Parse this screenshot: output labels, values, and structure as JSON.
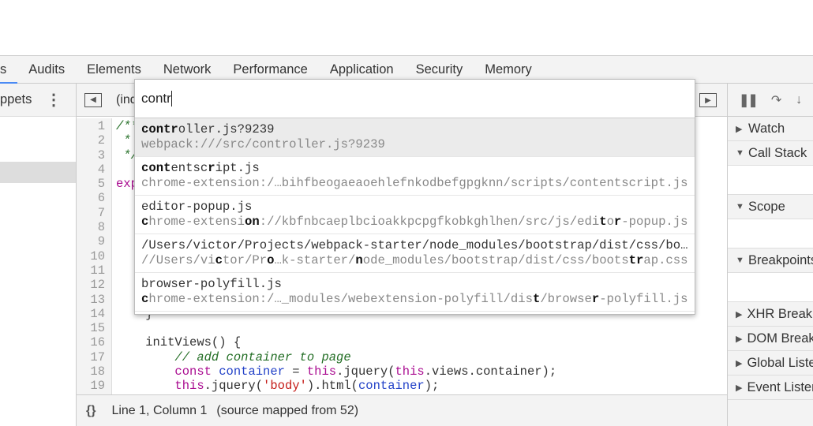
{
  "tabs": [
    "s",
    "Audits",
    "Elements",
    "Network",
    "Performance",
    "Application",
    "Security",
    "Memory"
  ],
  "sidebar": {
    "title": "ppets",
    "menu_icon": "kebab-icon"
  },
  "editor": {
    "file_label": "(ind",
    "lines": [
      {
        "n": "1",
        "parts": [
          [
            "c-com",
            "/**"
          ]
        ]
      },
      {
        "n": "2",
        "parts": [
          [
            "c-com",
            " *"
          ]
        ]
      },
      {
        "n": "3",
        "parts": [
          [
            "c-com",
            " */"
          ]
        ]
      },
      {
        "n": "4",
        "parts": []
      },
      {
        "n": "5",
        "parts": [
          [
            "c-kw",
            "exp"
          ]
        ]
      },
      {
        "n": "6",
        "parts": []
      },
      {
        "n": "7",
        "parts": []
      },
      {
        "n": "8",
        "parts": []
      },
      {
        "n": "9",
        "parts": []
      },
      {
        "n": "10",
        "parts": []
      },
      {
        "n": "11",
        "parts": []
      },
      {
        "n": "12",
        "parts": []
      },
      {
        "n": "13",
        "parts": []
      },
      {
        "n": "14",
        "parts": [
          [
            "",
            "    }"
          ]
        ]
      },
      {
        "n": "15",
        "parts": []
      },
      {
        "n": "16",
        "parts": [
          [
            "",
            "    initViews() {"
          ]
        ]
      },
      {
        "n": "17",
        "parts": [
          [
            "c-com",
            "        // add container to page"
          ]
        ]
      },
      {
        "n": "18",
        "parts": [
          [
            "c-kw",
            "        const "
          ],
          [
            "c-var",
            "container"
          ],
          [
            "",
            " = "
          ],
          [
            "c-kw",
            "this"
          ],
          [
            "",
            ".jquery("
          ],
          [
            "c-kw",
            "this"
          ],
          [
            "",
            ".views.container);"
          ]
        ]
      },
      {
        "n": "19",
        "parts": [
          [
            "c-kw",
            "        this"
          ],
          [
            "",
            ".jquery("
          ],
          [
            "c-str",
            "'body'"
          ],
          [
            "",
            ").html("
          ],
          [
            "c-var",
            "container"
          ],
          [
            "",
            ");"
          ]
        ]
      }
    ]
  },
  "status": {
    "braces": "{}",
    "position": "Line 1, Column 1",
    "mapped": "(source mapped from 52)"
  },
  "right": {
    "sections": [
      {
        "label": "Watch",
        "open": false
      },
      {
        "label": "Call Stack",
        "open": true
      },
      {
        "label": "Scope",
        "open": true
      },
      {
        "label": "Breakpoints",
        "open": true
      },
      {
        "label": "XHR Breakpoints",
        "open": false
      },
      {
        "label": "DOM Breakpoints",
        "open": false
      },
      {
        "label": "Global Listeners",
        "open": false
      },
      {
        "label": "Event Listeners",
        "open": false
      }
    ]
  },
  "quick_open": {
    "query": "contr",
    "items": [
      {
        "title": [
          [
            "contr",
            1
          ],
          [
            "oller.js?9239",
            0
          ]
        ],
        "path": [
          [
            "webpack:///src/controller.js?9239",
            0
          ]
        ]
      },
      {
        "title": [
          [
            "cont",
            1
          ],
          [
            "entsc",
            0
          ],
          [
            "r",
            1
          ],
          [
            "ipt.js",
            0
          ]
        ],
        "path": [
          [
            "chrome-extension:/…bihfbeogaeaoehlefnkodbefgpgknn/scripts/contentscript.js",
            0
          ]
        ]
      },
      {
        "title": [
          [
            "editor-popup.js",
            0
          ]
        ],
        "path": [
          [
            "c",
            1
          ],
          [
            "hrome-extensi",
            0
          ],
          [
            "on",
            1
          ],
          [
            "://kbfnbcaeplbcioakkpcpgfkobkghlhen/src/js/edi",
            0
          ],
          [
            "t",
            1
          ],
          [
            "o",
            0
          ],
          [
            "r",
            1
          ],
          [
            "-popup.js",
            0
          ]
        ]
      },
      {
        "title": [
          [
            "/Users/victor/Projects/webpack-starter/node_modules/bootstrap/dist/css/bo…",
            0
          ]
        ],
        "path": [
          [
            "//Users/vi",
            0
          ],
          [
            "c",
            1
          ],
          [
            "tor/Pr",
            0
          ],
          [
            "o",
            1
          ],
          [
            "…k-starter/",
            0
          ],
          [
            "n",
            1
          ],
          [
            "ode_modules/bootstrap/dist/css/boots",
            0
          ],
          [
            "tr",
            1
          ],
          [
            "ap.css",
            0
          ]
        ]
      },
      {
        "title": [
          [
            "browser-polyfill.js",
            0
          ]
        ],
        "path": [
          [
            "c",
            1
          ],
          [
            "hrome-extension:/…_modules/webextension-polyfill/dis",
            0
          ],
          [
            "t",
            1
          ],
          [
            "/browse",
            0
          ],
          [
            "r",
            1
          ],
          [
            "-polyfill.js",
            0
          ]
        ]
      }
    ]
  }
}
